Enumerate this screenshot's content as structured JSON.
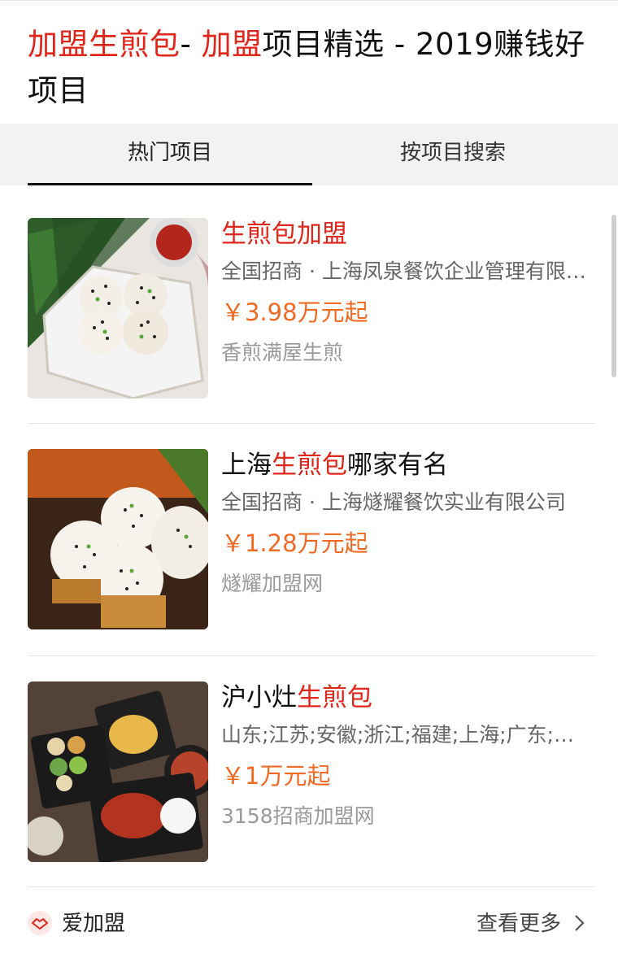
{
  "title": {
    "parts": [
      {
        "text": "加盟生煎包",
        "hl": true
      },
      {
        "text": "- ",
        "hl": false
      },
      {
        "text": "加盟",
        "hl": true
      },
      {
        "text": "项目精选 - 2019赚钱好项目",
        "hl": false
      }
    ]
  },
  "tabs": {
    "hot": "热门项目",
    "search": "按项目搜索"
  },
  "items": [
    {
      "name_parts": [
        {
          "text": "生煎包加盟",
          "hl": true
        }
      ],
      "desc": "全国招商 · 上海凤泉餐饮企业管理有限公司",
      "price": "￥3.98万元起",
      "source": "香煎满屋生煎",
      "image": "pan-fried-buns-plate-image"
    },
    {
      "name_parts": [
        {
          "text": "上海",
          "hl": false
        },
        {
          "text": "生煎包",
          "hl": true
        },
        {
          "text": "哪家有名",
          "hl": false
        }
      ],
      "desc": "全国招商 · 上海燧耀餐饮实业有限公司",
      "price": "￥1.28万元起",
      "source": "燧耀加盟网",
      "image": "pan-fried-buns-closeup-image"
    },
    {
      "name_parts": [
        {
          "text": "沪小灶",
          "hl": false
        },
        {
          "text": "生煎包",
          "hl": true
        }
      ],
      "desc": "山东;江苏;安徽;浙江;福建;上海;广东;北京",
      "price": "￥1万元起",
      "source": "3158招商加盟网",
      "image": "restaurant-dishes-table-image"
    }
  ],
  "footer": {
    "brand": "爱加盟",
    "more": "查看更多",
    "brand_icon": "handshake-icon",
    "more_icon": "chevron-right-icon"
  },
  "colors": {
    "highlight": "#e0261b",
    "price": "#f06a24",
    "muted": "#999999",
    "tab_bg": "#f2f2f2"
  }
}
